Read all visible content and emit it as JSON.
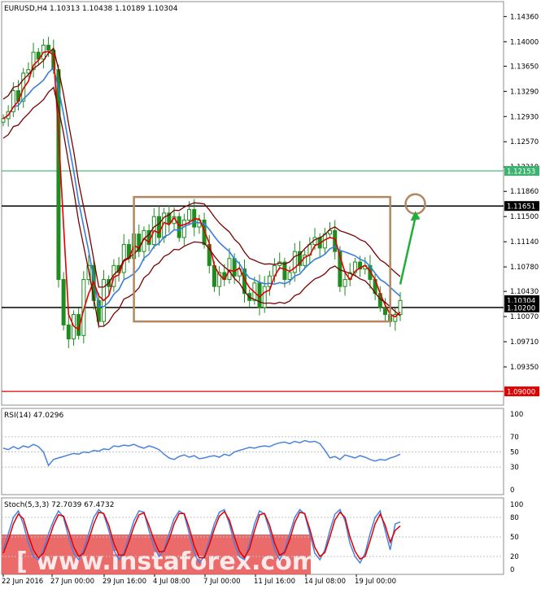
{
  "header": {
    "title": "EURUSD,H4  1.10313 1.10438 1.10189 1.10304"
  },
  "indicators": {
    "rsi_label": "RSI(14) 47.0296",
    "stoch_label": "Stoch(5,3,3) 72.7039 67.4732"
  },
  "watermark": "[ www.instaforex.com ]",
  "colors": {
    "candle": "#1e8c1e",
    "red_ma": "#e00000",
    "blue_ma": "#3a7de0",
    "band": "#7a0000",
    "box": "#b08862",
    "arrow": "#1fae3a",
    "green_line": "#3cb371",
    "red_line": "#e00000",
    "flag_black": "#000000",
    "flag_green": "#3cb371",
    "flag_red": "#e00000",
    "rsi": "#4a82e0",
    "stoch_main": "#4a82e0",
    "stoch_signal": "#e00000",
    "ref": "#c0c0c0",
    "overlay": "#e85050"
  },
  "chart_data": [
    {
      "type": "candlestick",
      "title": "EURUSD,H4",
      "ohlc_last": {
        "open": 1.10313,
        "high": 1.10438,
        "low": 1.10189,
        "close": 1.10304
      },
      "ylim": [
        1.0885,
        1.1455
      ],
      "y_ticks": [
        "1.14360",
        "1.14000",
        "1.13650",
        "1.13290",
        "1.12930",
        "1.12570",
        "1.12210",
        "1.11860",
        "1.11500",
        "1.11140",
        "1.10780",
        "1.10430",
        "1.10070",
        "1.09710",
        "1.09350"
      ],
      "x_ticks": [
        "22 Jun 2016",
        "27 Jun 00:00",
        "29 Jun 16:00",
        "4 Jul 08:00",
        "7 Jul 00:00",
        "11 Jul 16:00",
        "14 Jul 08:00",
        "19 Jul 00:00"
      ],
      "price_flags": [
        {
          "label": "1.12153",
          "value": 1.12153,
          "kind": "green"
        },
        {
          "label": "1.11651",
          "value": 1.11651,
          "kind": "black"
        },
        {
          "label": "1.10304",
          "value": 1.10304,
          "kind": "black"
        },
        {
          "label": "1.10200",
          "value": 1.102,
          "kind": "black"
        },
        {
          "label": "1.09000",
          "value": 1.09,
          "kind": "red"
        }
      ],
      "horizontal_lines": [
        {
          "value": 1.12153,
          "kind": "green"
        },
        {
          "value": 1.11651,
          "kind": "black"
        },
        {
          "value": 1.102,
          "kind": "black"
        },
        {
          "value": 1.09,
          "kind": "red"
        }
      ],
      "closes": [
        1.129,
        1.13,
        1.133,
        1.1315,
        1.1355,
        1.136,
        1.1385,
        1.1375,
        1.1395,
        1.1388,
        1.136,
        1.106,
        1.0995,
        1.0975,
        1.101,
        1.098,
        1.106,
        1.108,
        1.103,
        1.1,
        1.106,
        1.105,
        1.108,
        1.107,
        1.111,
        1.109,
        1.1125,
        1.11,
        1.113,
        1.111,
        1.115,
        1.112,
        1.1155,
        1.114,
        1.115,
        1.112,
        1.1145,
        1.116,
        1.1135,
        1.1145,
        1.111,
        1.108,
        1.105,
        1.107,
        1.106,
        1.109,
        1.1065,
        1.1075,
        1.104,
        1.103,
        1.1055,
        1.102,
        1.105,
        1.1065,
        1.108,
        1.1085,
        1.106,
        1.107,
        1.11,
        1.108,
        1.1095,
        1.111,
        1.112,
        1.1105,
        1.1125,
        1.113,
        1.11,
        1.105,
        1.106,
        1.107,
        1.1085,
        1.1075,
        1.108,
        1.106,
        1.104,
        1.102,
        1.101,
        1.1,
        1.101,
        1.103
      ],
      "annotations": [
        {
          "type": "rectangle",
          "x_range": [
            26,
            77
          ],
          "price_range": [
            1.1,
            1.1178
          ]
        },
        {
          "type": "circle",
          "x": 82,
          "price": 1.1168
        },
        {
          "type": "arrow",
          "from": [
            79,
            1.1053
          ],
          "to": [
            82,
            1.1158
          ]
        }
      ]
    },
    {
      "type": "line",
      "title": "RSI(14) 47.0296",
      "ylim": [
        0,
        100
      ],
      "y_ticks": [
        "100",
        "70",
        "50",
        "30",
        "0"
      ],
      "levels": [
        70,
        50,
        30
      ],
      "series": [
        {
          "values": [
            55,
            53,
            57,
            54,
            58,
            56,
            60,
            57,
            50,
            32,
            40,
            42,
            44,
            46,
            48,
            47,
            50,
            49,
            52,
            51,
            54,
            53,
            58,
            57,
            59,
            58,
            60,
            57,
            55,
            58,
            56,
            53,
            47,
            42,
            40,
            44,
            46,
            43,
            45,
            41,
            42,
            44,
            45,
            43,
            47,
            45,
            50,
            52,
            54,
            56,
            55,
            57,
            58,
            57,
            60,
            62,
            63,
            61,
            64,
            62,
            65,
            63,
            64,
            61,
            52,
            42,
            44,
            40,
            46,
            44,
            42,
            45,
            43,
            40,
            38,
            40,
            39,
            42,
            44,
            47
          ]
        }
      ]
    },
    {
      "type": "line",
      "title": "Stoch(5,3,3) 72.7039 67.4732",
      "ylim": [
        0,
        100
      ],
      "y_ticks": [
        "100",
        "80",
        "50",
        "20",
        "0"
      ],
      "levels": [
        80,
        50,
        20
      ],
      "series": [
        {
          "values": [
            30,
            55,
            80,
            90,
            70,
            40,
            20,
            15,
            30,
            55,
            75,
            90,
            80,
            50,
            25,
            15,
            30,
            55,
            80,
            92,
            85,
            60,
            30,
            15,
            25,
            50,
            75,
            90,
            88,
            60,
            35,
            20,
            30,
            55,
            78,
            90,
            85,
            55,
            25,
            10,
            20,
            45,
            70,
            88,
            92,
            70,
            40,
            20,
            15,
            40,
            70,
            90,
            85,
            60,
            30,
            15,
            30,
            55,
            80,
            92,
            85,
            55,
            25,
            15,
            30,
            60,
            85,
            92,
            75,
            40,
            20,
            10,
            25,
            55,
            80,
            90,
            60,
            30,
            70,
            73
          ]
        },
        {
          "values": [
            25,
            45,
            70,
            85,
            78,
            52,
            30,
            18,
            25,
            45,
            68,
            84,
            82,
            60,
            35,
            20,
            25,
            45,
            70,
            88,
            86,
            68,
            40,
            22,
            22,
            42,
            66,
            84,
            87,
            68,
            45,
            27,
            28,
            46,
            70,
            86,
            86,
            64,
            36,
            18,
            18,
            38,
            62,
            82,
            89,
            76,
            50,
            28,
            18,
            32,
            60,
            84,
            86,
            68,
            40,
            22,
            26,
            46,
            72,
            88,
            86,
            62,
            34,
            20,
            26,
            50,
            76,
            88,
            80,
            50,
            28,
            16,
            20,
            44,
            70,
            85,
            68,
            42,
            60,
            67
          ]
        }
      ]
    }
  ]
}
